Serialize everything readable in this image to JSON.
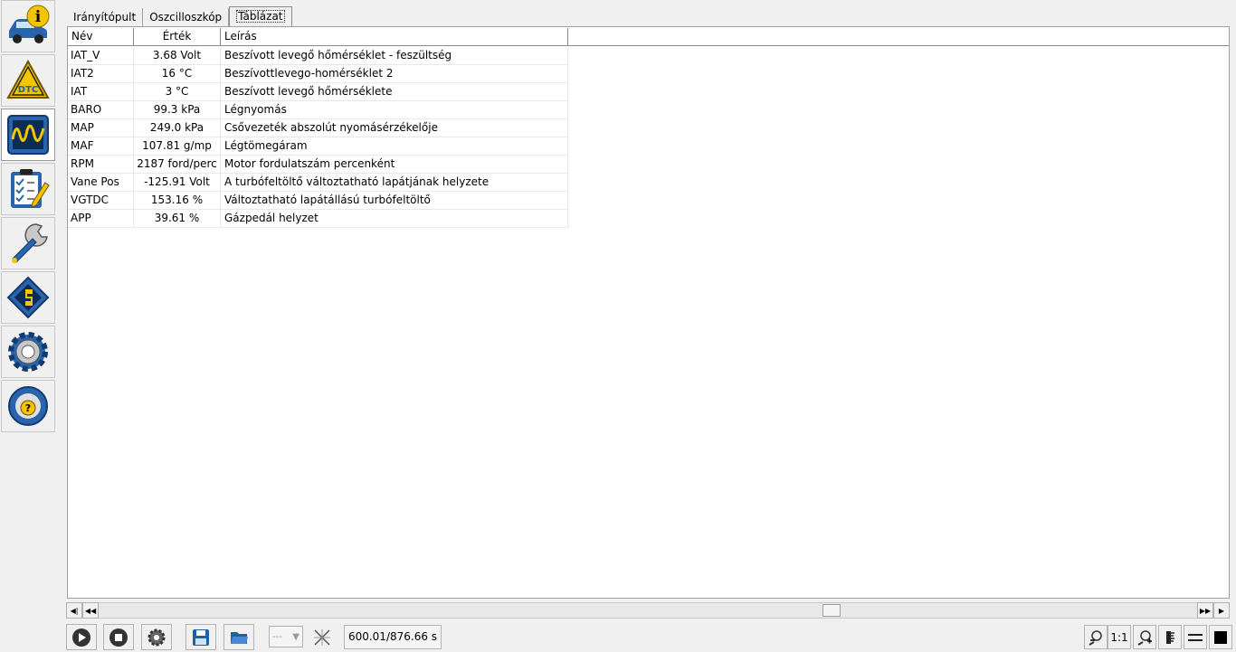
{
  "sidebar": {
    "items": [
      {
        "icon": "vehicle-info-icon"
      },
      {
        "icon": "dtc-warning-icon",
        "label": "DTC"
      },
      {
        "icon": "oscilloscope-icon"
      },
      {
        "icon": "checklist-icon"
      },
      {
        "icon": "wrench-icon"
      },
      {
        "icon": "chip-icon"
      },
      {
        "icon": "settings-gear-icon"
      },
      {
        "icon": "help-steering-icon"
      }
    ]
  },
  "tabs": [
    {
      "label": "Irányítópult"
    },
    {
      "label": "Oszcilloszkóp"
    },
    {
      "label": "Táblázat",
      "active": true
    }
  ],
  "table": {
    "headers": [
      "Név",
      "Érték",
      "Leírás"
    ],
    "rows": [
      {
        "name": "IAT_V",
        "value": "3.68 Volt",
        "desc": "Beszívott levegő hőmérséklet - feszültség"
      },
      {
        "name": "IAT2",
        "value": "16 °C",
        "desc": "Beszívottlevego-homérséklet 2"
      },
      {
        "name": "IAT",
        "value": "3 °C",
        "desc": "Beszívott levegő hőmérséklete"
      },
      {
        "name": "BARO",
        "value": "99.3 kPa",
        "desc": "Légnyomás"
      },
      {
        "name": "MAP",
        "value": "249.0 kPa",
        "desc": "Csővezeték abszolút nyomásérzékelője"
      },
      {
        "name": "MAF",
        "value": "107.81 g/mp",
        "desc": "Légtömegáram"
      },
      {
        "name": "RPM",
        "value": "2187 ford/perc",
        "desc": "Motor fordulatszám percenként"
      },
      {
        "name": "Vane Pos",
        "value": "-125.91 Volt",
        "desc": "A turbófeltöltő változtatható lapátjának helyzete"
      },
      {
        "name": "VGTDC",
        "value": "153.16 %",
        "desc": "Változtatható lapátállású turbófeltöltő"
      },
      {
        "name": "APP",
        "value": "39.61 %",
        "desc": "Gázpedál helyzet"
      }
    ]
  },
  "scrollbar": {
    "position_fraction": 0.67
  },
  "toolbar": {
    "combo_value": "---",
    "time_readout": "600.01/876.66 s",
    "zoom_ratio_label": "1:1"
  },
  "colors": {
    "accent_blue": "#1f5fa8",
    "accent_yellow": "#f5c400",
    "panel_border": "#a0a0a0"
  }
}
